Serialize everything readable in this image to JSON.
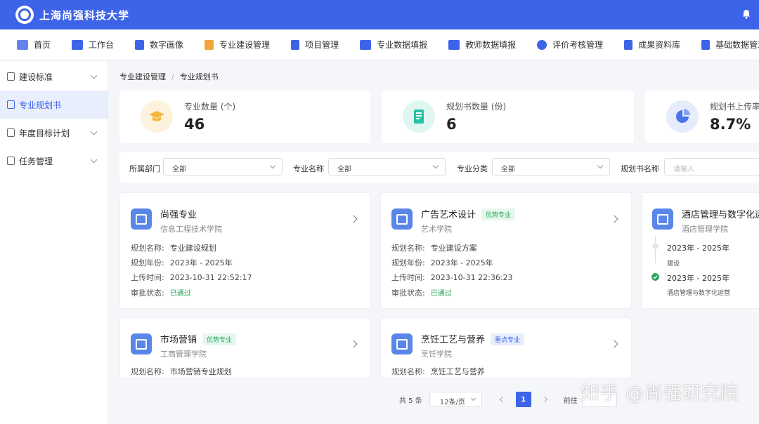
{
  "header": {
    "title": "上海尚强科技大学"
  },
  "nav": [
    {
      "label": "首页",
      "icon": "chart-line-icon",
      "color": "#3d63e8"
    },
    {
      "label": "工作台",
      "icon": "grid-icon",
      "color": "#3d63e8"
    },
    {
      "label": "数字画像",
      "icon": "id-card-icon",
      "color": "#3d63e8"
    },
    {
      "label": "专业建设管理",
      "icon": "shield-icon",
      "color": "#f0a63a"
    },
    {
      "label": "项目管理",
      "icon": "flask-icon",
      "color": "#3d63e8"
    },
    {
      "label": "专业数据填报",
      "icon": "form-icon",
      "color": "#3d63e8"
    },
    {
      "label": "教师数据填报",
      "icon": "teacher-card-icon",
      "color": "#3d63e8"
    },
    {
      "label": "评价考核管理",
      "icon": "evaluation-icon",
      "color": "#3d63e8"
    },
    {
      "label": "成果资料库",
      "icon": "books-icon",
      "color": "#3d63e8"
    },
    {
      "label": "基础数据管理",
      "icon": "database-icon",
      "color": "#3d63e8"
    }
  ],
  "sidebar": {
    "items": [
      {
        "label": "建设标准",
        "expandable": true
      },
      {
        "label": "专业规划书",
        "active": true
      },
      {
        "label": "年度目标计划",
        "expandable": true
      },
      {
        "label": "任务管理",
        "expandable": true
      }
    ]
  },
  "breadcrumb": {
    "parent": "专业建设管理",
    "sep": "/",
    "current": "专业规划书"
  },
  "stats": [
    {
      "label": "专业数量 (个)",
      "value": "46",
      "color": "#f5b63a",
      "bg": "#fdf3dc"
    },
    {
      "label": "规划书数量 (份)",
      "value": "6",
      "color": "#2bbfa3",
      "bg": "#dff6f1"
    },
    {
      "label": "规划书上传率",
      "value": "8.7%",
      "color": "#4a74e8",
      "bg": "#e6ecfc"
    }
  ],
  "filters": {
    "dept_label": "所属部门",
    "dept_value": "全部",
    "major_label": "专业名称",
    "major_value": "全部",
    "category_label": "专业分类",
    "category_value": "全部",
    "plan_label": "规划书名称",
    "plan_placeholder": "请输入"
  },
  "cards": [
    {
      "name": "尚强专业",
      "dept": "信息工程技术学院",
      "plan_label": "规划名称:",
      "plan": "专业建设规划",
      "year_label": "规划年份:",
      "year": "2023年 - 2025年",
      "time_label": "上传时间:",
      "time": "2023-10-31 22:52:17",
      "status_label": "审批状态:",
      "status": "已通过"
    },
    {
      "name": "广告艺术设计",
      "badge": "优势专业",
      "dept": "艺术学院",
      "plan_label": "规划名称:",
      "plan": "专业建设方案",
      "year_label": "规划年份:",
      "year": "2023年 - 2025年",
      "time_label": "上传时间:",
      "time": "2023-10-31 22:36:23",
      "status_label": "审批状态:",
      "status": "已通过"
    },
    {
      "name": "酒店管理与数字化运营",
      "dept": "酒店管理学院",
      "tl1": "2023年 - 2025年",
      "tl1_sub": "建设",
      "tl2": "2023年 - 2025年",
      "tl2_sub": "酒店管理与数字化运营"
    },
    {
      "name": "市场营销",
      "badge": "优势专业",
      "dept": "工商管理学院",
      "plan_label": "规划名称:",
      "plan": "市场营销专业规划"
    },
    {
      "name": "烹饪工艺与营养",
      "badge": "重点专业",
      "dept": "烹饪学院",
      "plan_label": "规划名称:",
      "plan": "烹饪工艺与营养"
    }
  ],
  "pagination": {
    "total": "共 5 条",
    "page_size": "12条/页",
    "current": "1",
    "goto": "前往"
  },
  "watermark": "知乎 @尚强研究院"
}
